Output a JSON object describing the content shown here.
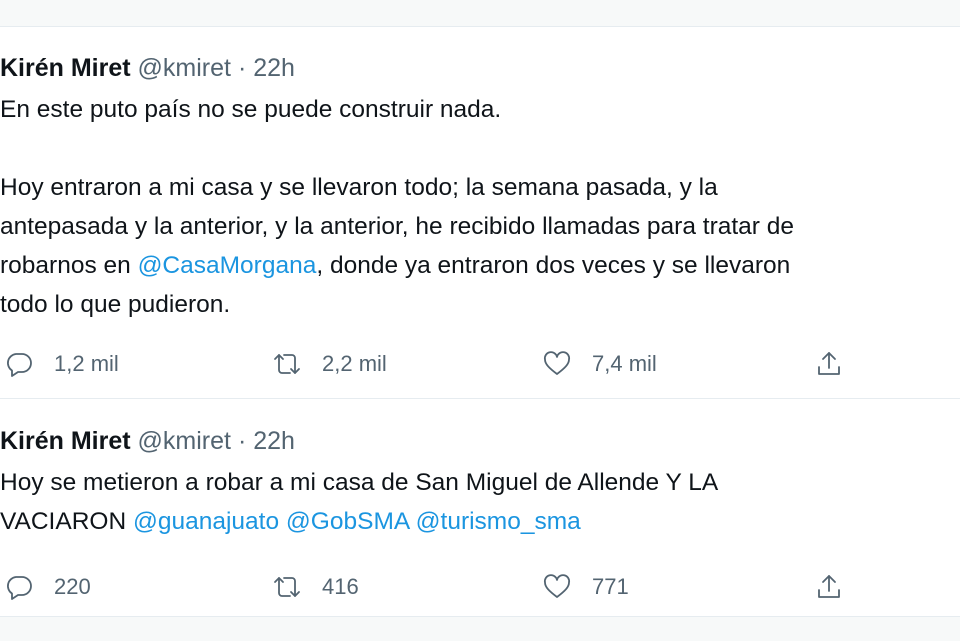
{
  "tweets": [
    {
      "author_name": "Kirén Miret",
      "handle": "@kmiret",
      "separator": "·",
      "time": "22h",
      "lines": [
        [
          {
            "text": "En este puto país no se puede construir nada."
          }
        ],
        [],
        [
          {
            "text": "Hoy entraron a mi casa y se llevaron todo; la semana pasada, y la"
          }
        ],
        [
          {
            "text": "antepasada y la anterior, y la anterior, he recibido llamadas para tratar de"
          }
        ],
        [
          {
            "text": "robarnos en "
          },
          {
            "text": "@CasaMorgana",
            "mention": true
          },
          {
            "text": ", donde ya entraron dos veces y se llevaron"
          }
        ],
        [
          {
            "text": "todo lo que pudieron."
          }
        ]
      ],
      "replies": "1,2 mil",
      "retweets": "2,2 mil",
      "likes": "7,4 mil"
    },
    {
      "author_name": "Kirén Miret",
      "handle": "@kmiret",
      "separator": "·",
      "time": "22h",
      "lines": [
        [
          {
            "text": "Hoy se metieron a robar a mi casa de San Miguel de Allende Y LA"
          }
        ],
        [
          {
            "text": "VACIARON "
          },
          {
            "text": "@guanajuato",
            "mention": true
          },
          {
            "text": " "
          },
          {
            "text": "@GobSMA",
            "mention": true
          },
          {
            "text": " "
          },
          {
            "text": "@turismo_sma",
            "mention": true
          }
        ]
      ],
      "replies": "220",
      "retweets": "416",
      "likes": "771"
    }
  ],
  "icons": {
    "reply": "reply-icon",
    "retweet": "retweet-icon",
    "like": "like-icon",
    "share": "share-icon"
  },
  "colors": {
    "text": "#0f1419",
    "secondary": "#536471",
    "mention": "#1b95e0",
    "divider": "#e6ecf0"
  }
}
